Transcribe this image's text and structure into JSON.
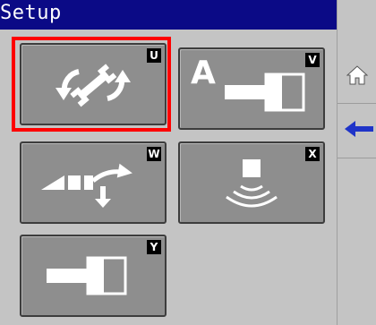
{
  "title": "Setup",
  "colors": {
    "title_bar": "#0b0a86",
    "selection": "#ff0000",
    "button_face": "#8e8e8e",
    "back_arrow": "#1f34c8"
  },
  "buttons": [
    {
      "key": "U",
      "icon": "wrench-refresh-icon",
      "selected": true
    },
    {
      "key": "V",
      "icon": "auto-cylinder-icon",
      "label": "A"
    },
    {
      "key": "W",
      "icon": "implement-lower-icon"
    },
    {
      "key": "X",
      "icon": "sensor-waves-icon"
    },
    {
      "key": "Y",
      "icon": "cylinder-icon"
    }
  ],
  "softkeys": [
    {
      "icon": "home-icon"
    },
    {
      "icon": "back-arrow-icon"
    }
  ]
}
